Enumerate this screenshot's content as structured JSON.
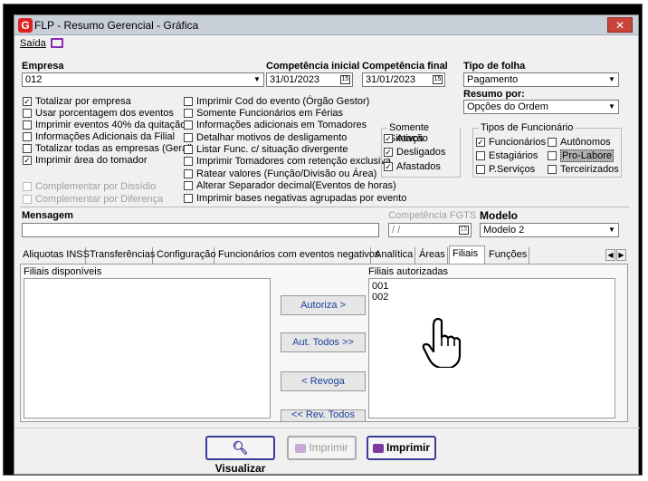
{
  "window": {
    "title": "FLP - Resumo Gerencial - Gráfica",
    "close_glyph": "✕",
    "logo_letter": "G"
  },
  "menu": {
    "saida": "Saída"
  },
  "empresa": {
    "label": "Empresa",
    "value": "012"
  },
  "competencia_inicial": {
    "label": "Competência inicial",
    "value": "31/01/2023"
  },
  "competencia_final": {
    "label": "Competência final",
    "value": "31/01/2023"
  },
  "tipo_folha": {
    "label": "Tipo de folha",
    "value": "Pagamento"
  },
  "resumo_por": {
    "label": "Resumo por:",
    "value": "Opções do Ordem"
  },
  "left_checks": [
    {
      "label": "Totalizar por empresa",
      "checked": true
    },
    {
      "label": "Usar porcentagem dos eventos",
      "checked": false
    },
    {
      "label": "Imprimir eventos 40% da quitação",
      "checked": false
    },
    {
      "label": "Informações Adicionais da Filial",
      "checked": false
    },
    {
      "label": "Totalizar todas as empresas (Geral)",
      "checked": false
    },
    {
      "label": "Imprimir área do tomador",
      "checked": true
    }
  ],
  "disabled_checks": [
    {
      "label": "Complementar por Dissídio"
    },
    {
      "label": "Complementar por Diferença"
    }
  ],
  "mid_checks": [
    {
      "label": "Imprimir Cod do evento (Órgão Gestor)"
    },
    {
      "label": "Somente Funcionários em Férias"
    },
    {
      "label": "Informações adicionais em Tomadores"
    },
    {
      "label": "Detalhar motivos de desligamento"
    },
    {
      "label": "Listar Func. c/ situação divergente"
    },
    {
      "label": "Imprimir Tomadores com retenção exclusiva"
    },
    {
      "label": "Ratear valores (Função/Divisão ou Área)"
    },
    {
      "label": "Alterar Separador decimal(Eventos de horas)"
    },
    {
      "label": "Imprimir bases negativas agrupadas por evento"
    }
  ],
  "situacao": {
    "title": "Somente Situação",
    "items": [
      {
        "label": "Ativos",
        "checked": true
      },
      {
        "label": "Desligados",
        "checked": true
      },
      {
        "label": "Afastados",
        "checked": true
      }
    ]
  },
  "tipos_func": {
    "title": "Tipos de Funcionário",
    "funcionarios": "Funcionários",
    "autonomos": "Autônomos",
    "estagiarios": "Estagiários",
    "prolabore": "Pro-Labore",
    "pservicos": "P.Serviços",
    "terceirizados": "Terceirizados"
  },
  "mensagem": {
    "label": "Mensagem",
    "value": ""
  },
  "competencia_fgts": {
    "label": "Competência FGTS",
    "value": " / /"
  },
  "modelo": {
    "label": "Modelo",
    "value": "Modelo 2"
  },
  "tabs": [
    "Aliquotas INSS",
    "Transferências",
    "Configuração",
    "Funcionários com eventos negativos",
    "Analítica",
    "Áreas",
    "Filiais",
    "Funções"
  ],
  "filiais": {
    "disponiveis_label": "Filiais disponíveis",
    "autorizadas_label": "Filiais autorizadas",
    "autorizadas": [
      "001",
      "002"
    ],
    "autoriza": "Autoriza >",
    "aut_todos": "Aut. Todos >>",
    "revoga": "< Revoga",
    "rev_todos": "<< Rev. Todos"
  },
  "bottom": {
    "visualizar": "Visualizar",
    "imprimir_dis": "Imprimir",
    "imprimir": "Imprimir"
  },
  "glyphs": {
    "check": "✓",
    "dd": "▼",
    "cal": "15",
    "left": "◀",
    "right": "▶"
  }
}
